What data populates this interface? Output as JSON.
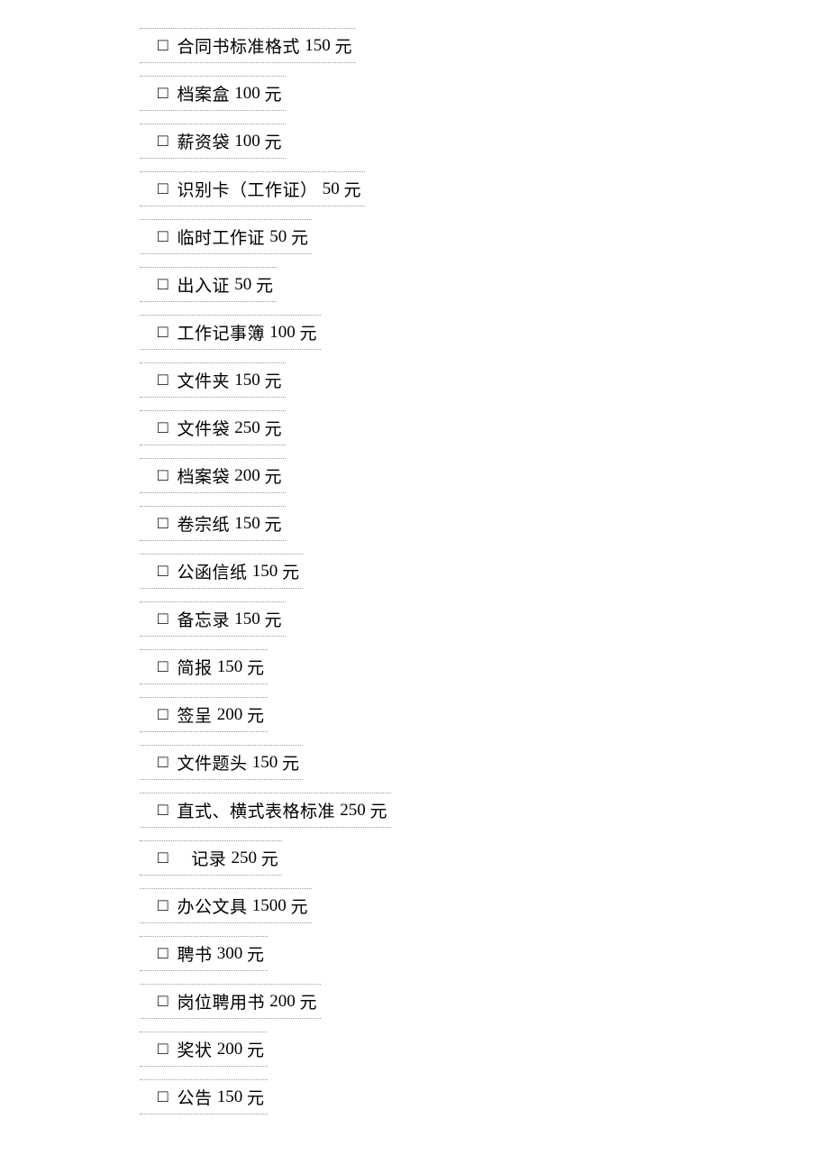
{
  "checkbox_glyph": "□",
  "currency_unit": " 元",
  "items": [
    {
      "label": "合同书标准格式 ",
      "value": "150"
    },
    {
      "label": "档案盒 ",
      "value": "100"
    },
    {
      "label": "薪资袋 ",
      "value": "100"
    },
    {
      "label": "识别卡（工作证） ",
      "value": "50"
    },
    {
      "label": "临时工作证 ",
      "value": "50"
    },
    {
      "label": "出入证 ",
      "value": "50"
    },
    {
      "label": "工作记事簿 ",
      "value": "100"
    },
    {
      "label": "文件夹 ",
      "value": "150"
    },
    {
      "label": "文件袋 ",
      "value": "250"
    },
    {
      "label": "档案袋 ",
      "value": "200"
    },
    {
      "label": "卷宗纸 ",
      "value": "150"
    },
    {
      "label": "公函信纸 ",
      "value": "150"
    },
    {
      "label": "备忘录 ",
      "value": "150"
    },
    {
      "label": "简报 ",
      "value": "150"
    },
    {
      "label": "签呈 ",
      "value": "200"
    },
    {
      "label": "文件题头 ",
      "value": "150"
    },
    {
      "label": "直式、横式表格标准 ",
      "value": "250"
    },
    {
      "label": "   记录 ",
      "value": "250"
    },
    {
      "label": "办公文具 ",
      "value": "1500"
    },
    {
      "label": "聘书 ",
      "value": "300"
    },
    {
      "label": "岗位聘用书 ",
      "value": "200"
    },
    {
      "label": "奖状 ",
      "value": "200"
    },
    {
      "label": "公告 ",
      "value": "150"
    }
  ]
}
